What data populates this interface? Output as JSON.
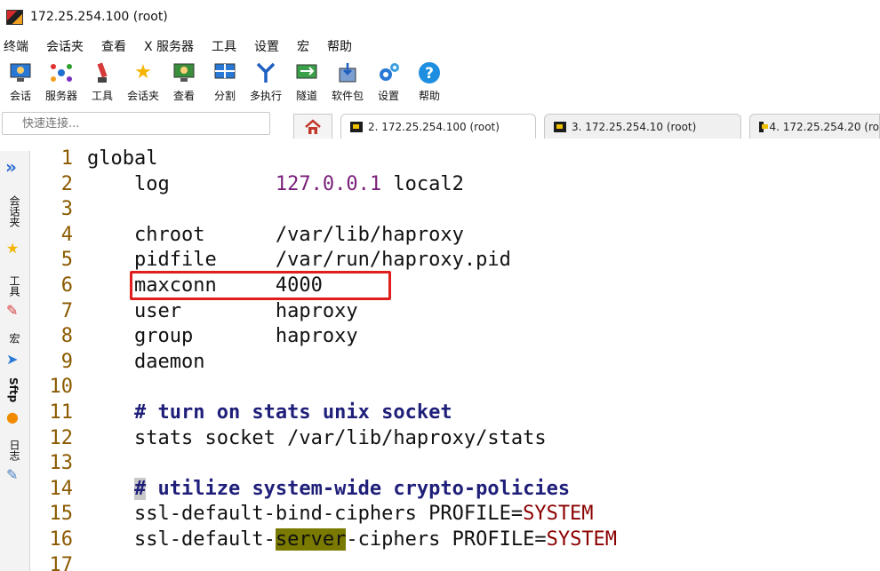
{
  "window": {
    "title": "172.25.254.100 (root)"
  },
  "menu": [
    "终端",
    "会话夹",
    "查看",
    "X 服务器",
    "工具",
    "设置",
    "宏",
    "帮助"
  ],
  "toolbar": [
    {
      "label": "会话",
      "icon": "session-icon"
    },
    {
      "label": "服务器",
      "icon": "servers-icon"
    },
    {
      "label": "工具",
      "icon": "tools-icon"
    },
    {
      "label": "会话夹",
      "icon": "star-icon"
    },
    {
      "label": "查看",
      "icon": "view-icon"
    },
    {
      "label": "分割",
      "icon": "split-icon"
    },
    {
      "label": "多执行",
      "icon": "multiexec-icon"
    },
    {
      "label": "隧道",
      "icon": "tunnel-icon"
    },
    {
      "label": "软件包",
      "icon": "packages-icon"
    },
    {
      "label": "设置",
      "icon": "settings-icon"
    },
    {
      "label": "帮助",
      "icon": "help-icon"
    }
  ],
  "quick_connect": {
    "placeholder": "快速连接..."
  },
  "tabs": [
    {
      "label": "2. 172.25.254.100 (root)",
      "active": true
    },
    {
      "label": "3. 172.25.254.10 (root)",
      "active": false
    },
    {
      "label": "4. 172.25.254.20 (ro",
      "active": false
    }
  ],
  "sidebar": {
    "sessions_label": "会话夹",
    "tools_label": "工具",
    "macros_label": "宏",
    "sftp_label": "Sftp",
    "log_label": "日志"
  },
  "editor": {
    "lines": [
      {
        "n": "1",
        "parts": [
          {
            "t": "global",
            "c": ""
          }
        ]
      },
      {
        "n": "2",
        "parts": [
          {
            "t": "    log         ",
            "c": ""
          },
          {
            "t": "127.0.0.1",
            "c": "num"
          },
          {
            "t": " local2",
            "c": ""
          }
        ]
      },
      {
        "n": "3",
        "parts": []
      },
      {
        "n": "4",
        "parts": [
          {
            "t": "    chroot      /var/lib/haproxy",
            "c": ""
          }
        ]
      },
      {
        "n": "5",
        "parts": [
          {
            "t": "    pidfile     /var/run/haproxy.pid",
            "c": ""
          }
        ]
      },
      {
        "n": "6",
        "parts": [
          {
            "t": "    maxconn     4000",
            "c": ""
          }
        ]
      },
      {
        "n": "7",
        "parts": [
          {
            "t": "    user        haproxy",
            "c": ""
          }
        ]
      },
      {
        "n": "8",
        "parts": [
          {
            "t": "    group       haproxy",
            "c": ""
          }
        ]
      },
      {
        "n": "9",
        "parts": [
          {
            "t": "    daemon",
            "c": ""
          }
        ]
      },
      {
        "n": "10",
        "parts": []
      },
      {
        "n": "11",
        "parts": [
          {
            "t": "    ",
            "c": ""
          },
          {
            "t": "# turn on stats unix socket",
            "c": "comment"
          }
        ]
      },
      {
        "n": "12",
        "parts": [
          {
            "t": "    stats socket /var/lib/haproxy/stats",
            "c": ""
          }
        ]
      },
      {
        "n": "13",
        "parts": []
      },
      {
        "n": "14",
        "parts": [
          {
            "t": "    ",
            "c": ""
          },
          {
            "t": "#",
            "c": "cursor-sq comment"
          },
          {
            "t": " utilize system-wide crypto-policies",
            "c": "comment"
          }
        ]
      },
      {
        "n": "15",
        "parts": [
          {
            "t": "    ssl-default-bind-ciphers PROFILE=",
            "c": ""
          },
          {
            "t": "SYSTEM",
            "c": "const"
          }
        ]
      },
      {
        "n": "16",
        "parts": [
          {
            "t": "    ssl-default-",
            "c": ""
          },
          {
            "t": "server",
            "c": "hl"
          },
          {
            "t": "-ciphers PROFILE=",
            "c": ""
          },
          {
            "t": "SYSTEM",
            "c": "const"
          }
        ]
      },
      {
        "n": "17",
        "parts": []
      }
    ]
  }
}
